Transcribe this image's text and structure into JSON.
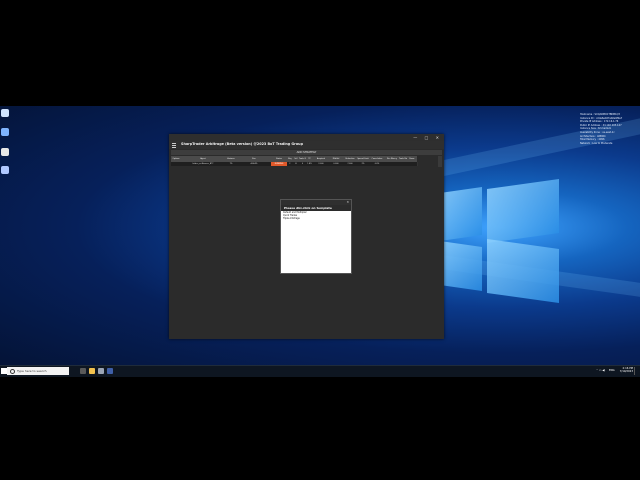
{
  "app": {
    "title": "SharpTrader Arbitrage (Beta version) @2023 BoT Trading Group",
    "add_strategy_label": "ADD STRATEGY",
    "window_controls": [
      "—",
      "□",
      "✕"
    ]
  },
  "table": {
    "columns": [
      "Options",
      "Agent",
      "Variance",
      "Size",
      "Status",
      "Buy",
      "Sell",
      "Trade Gain",
      "TP",
      "Acquired",
      "Mid-Vol",
      "Reduction",
      "Spread Limit",
      "Cancelation",
      "Rec.Money",
      "Trade Rate",
      "Pause"
    ],
    "row": [
      "",
      "bitdex_vs:Binance_BTC",
      "7%",
      "400/4%",
      "RUNNING",
      "F",
      "B",
      "0",
      "1.8%",
      "2,000",
      "0.000",
      "7,000",
      "2%",
      "0.0%",
      "",
      "",
      ""
    ]
  },
  "dialog": {
    "title": "Please dbl-click on template",
    "items": [
      "Default and Multiplier",
      "Quick Trades",
      "Triple Arbitrage"
    ]
  },
  "system_info": [
    "Hostname : SCQARMO1TBDB1Q3",
    "Instance ID : i-0de6e0d7ab0e9f0e7",
    "Private IP Address : 172.16.1.76",
    "Public IP Address : 44.192.103.147",
    "Instance Size : t2.medium",
    "Availability Zone : us-east-1c",
    "Architecture : AMD64",
    "Total Memory : 4096",
    "Network : Low to Moderate"
  ],
  "taskbar": {
    "search_placeholder": "Type here to search",
    "language": "ENG",
    "time": "2:16 PM",
    "date": "7/19/2023"
  },
  "colors": {
    "accent_orange": "#e0592a",
    "app_bg": "#2b2b2b",
    "header_bg": "#4b4b4b"
  }
}
